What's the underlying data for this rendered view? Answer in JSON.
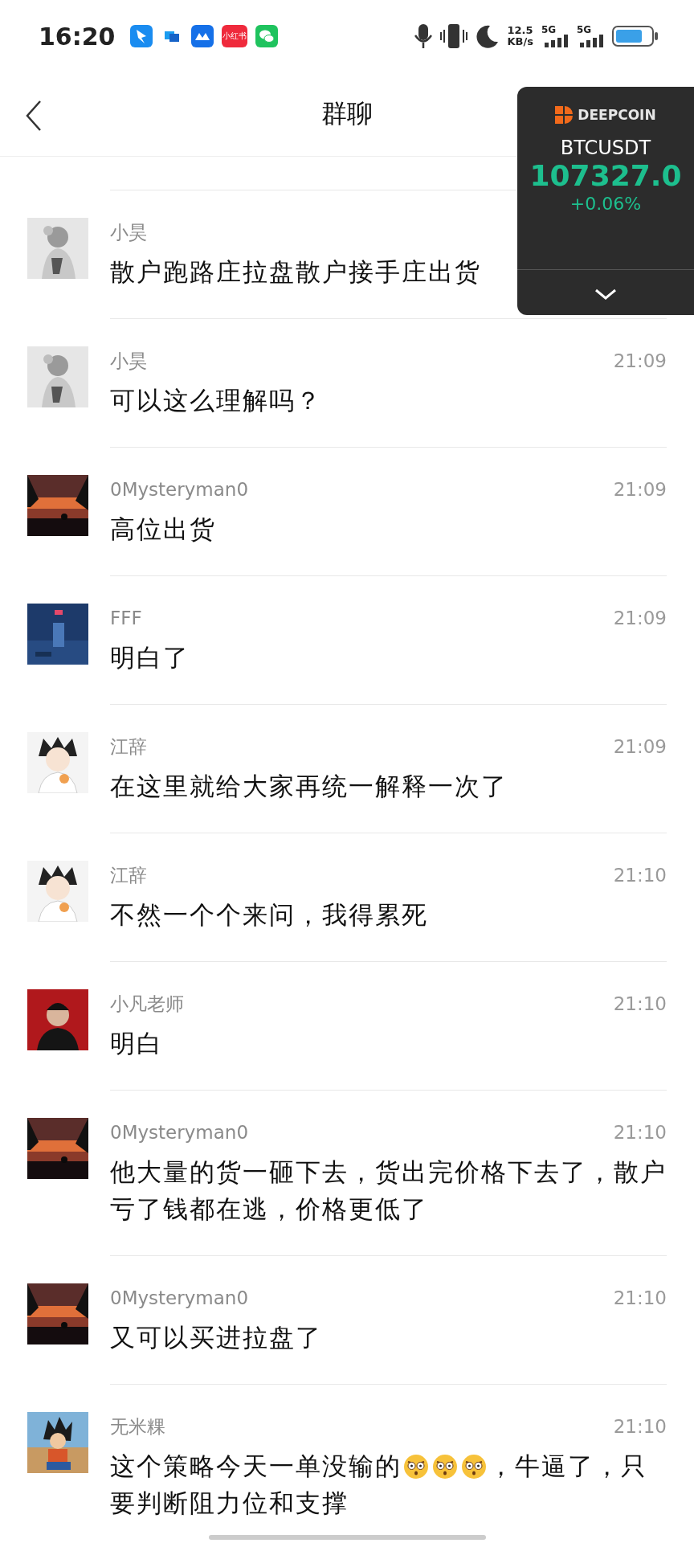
{
  "status_bar": {
    "time": "16:20",
    "apps": [
      {
        "kind": "blue"
      },
      {
        "kind": "chat"
      },
      {
        "kind": "cloud"
      },
      {
        "kind": "label",
        "label": "小红书"
      },
      {
        "kind": "wechat"
      }
    ],
    "speed": "12.5",
    "speed_unit": "KB/s",
    "networks": [
      "5G",
      "5G"
    ]
  },
  "header": {
    "title": "群聊"
  },
  "ticker": {
    "brand": "DEEPCOIN",
    "symbol": "BTCUSDT",
    "price": "107327.0",
    "change": "+0.06%"
  },
  "messages": [
    {
      "sender": "小昊",
      "segments": [
        {
          "kind": "text",
          "text": "散户跑路庄拉盘散户接手庄出货"
        }
      ]
    },
    {
      "sender": "小昊",
      "time": "21:09",
      "segments": [
        {
          "kind": "text",
          "text": "可以这么理解吗？"
        }
      ]
    },
    {
      "sender": "0Mysteryman0",
      "time": "21:09",
      "segments": [
        {
          "kind": "text",
          "text": "高位出货"
        }
      ]
    },
    {
      "sender": "FFF",
      "time": "21:09",
      "segments": [
        {
          "kind": "text",
          "text": "明白了"
        }
      ]
    },
    {
      "sender": "江辞",
      "time": "21:09",
      "segments": [
        {
          "kind": "text",
          "text": "在这里就给大家再统一解释一次了"
        }
      ]
    },
    {
      "sender": "江辞",
      "time": "21:10",
      "segments": [
        {
          "kind": "text",
          "text": "不然一个个来问，我得累死"
        }
      ]
    },
    {
      "sender": "小凡老师",
      "time": "21:10",
      "segments": [
        {
          "kind": "text",
          "text": "明白"
        }
      ]
    },
    {
      "sender": "0Mysteryman0",
      "time": "21:10",
      "segments": [
        {
          "kind": "text",
          "text": "他大量的货一砸下去，货出完价格下去了，散户亏了钱都在逃，价格更低了"
        }
      ]
    },
    {
      "sender": "0Mysteryman0",
      "time": "21:10",
      "segments": [
        {
          "kind": "text",
          "text": "又可以买进拉盘了"
        }
      ]
    },
    {
      "sender": "无米粿",
      "time": "21:10",
      "segments": [
        {
          "kind": "text",
          "text": "这个策略今天一单没输的"
        },
        {
          "kind": "emoji"
        },
        {
          "kind": "emoji"
        },
        {
          "kind": "emoji"
        },
        {
          "kind": "text",
          "text": "，牛逼了，只要判断阻力位和支撑"
        }
      ]
    }
  ]
}
